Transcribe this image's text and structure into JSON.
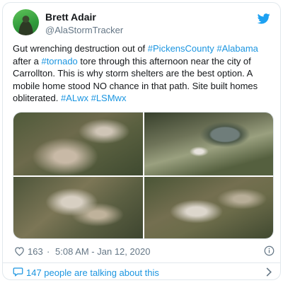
{
  "author": {
    "name": "Brett Adair",
    "handle": "@AlaStormTracker",
    "avatar_icon": "profile-photo"
  },
  "tweet": {
    "segments": [
      {
        "text": "Gut wrenching destruction out of ",
        "link": false
      },
      {
        "text": "#PickensCounty",
        "link": true
      },
      {
        "text": " ",
        "link": false
      },
      {
        "text": "#Alabama",
        "link": true
      },
      {
        "text": " after a ",
        "link": false
      },
      {
        "text": "#tornado",
        "link": true
      },
      {
        "text": " tore through this afternoon near the city of Carrollton.  This is why storm shelters are the best option.  A mobile home stood NO chance in that path.  Site built homes obliterated.  ",
        "link": false
      },
      {
        "text": "#ALwx",
        "link": true
      },
      {
        "text": " ",
        "link": false
      },
      {
        "text": "#LSMwx",
        "link": true
      }
    ]
  },
  "media": {
    "photo_count": 4
  },
  "meta": {
    "likes": "163",
    "separator": "·",
    "timestamp": "5:08 AM - Jan 12, 2020"
  },
  "footer": {
    "talking_text": "147 people are talking about this"
  },
  "colors": {
    "link": "#1b95e0",
    "text": "#14171a",
    "muted": "#657786",
    "border": "#e1e8ed",
    "twitter_blue": "#1da1f2"
  }
}
